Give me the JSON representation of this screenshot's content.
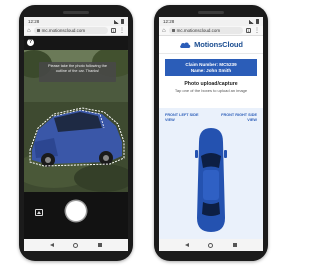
{
  "left_phone": {
    "status_time": "12:28",
    "url": "mc.motionscloud.com",
    "tab_count": "1",
    "instruction": "Please take the photo following the outline of the car. Thanks!"
  },
  "right_phone": {
    "status_time": "12:28",
    "url": "mc.motionscloud.com",
    "tab_count": "1",
    "brand": "MotionsCloud",
    "claim_number": "Claim Number: MC5239",
    "claim_name": "Name: John Smith",
    "upload_title": "Photo upload/capture",
    "upload_subtitle": "Tap one of the boxes to upload an image",
    "front_left": "FRONT LEFT SIDE VIEW",
    "front_right": "FRONT RIGHT SIDE VIEW"
  },
  "colors": {
    "brand_blue": "#2b5db8",
    "car_blue": "#2452b0",
    "phone_body": "#1b1b1b"
  }
}
